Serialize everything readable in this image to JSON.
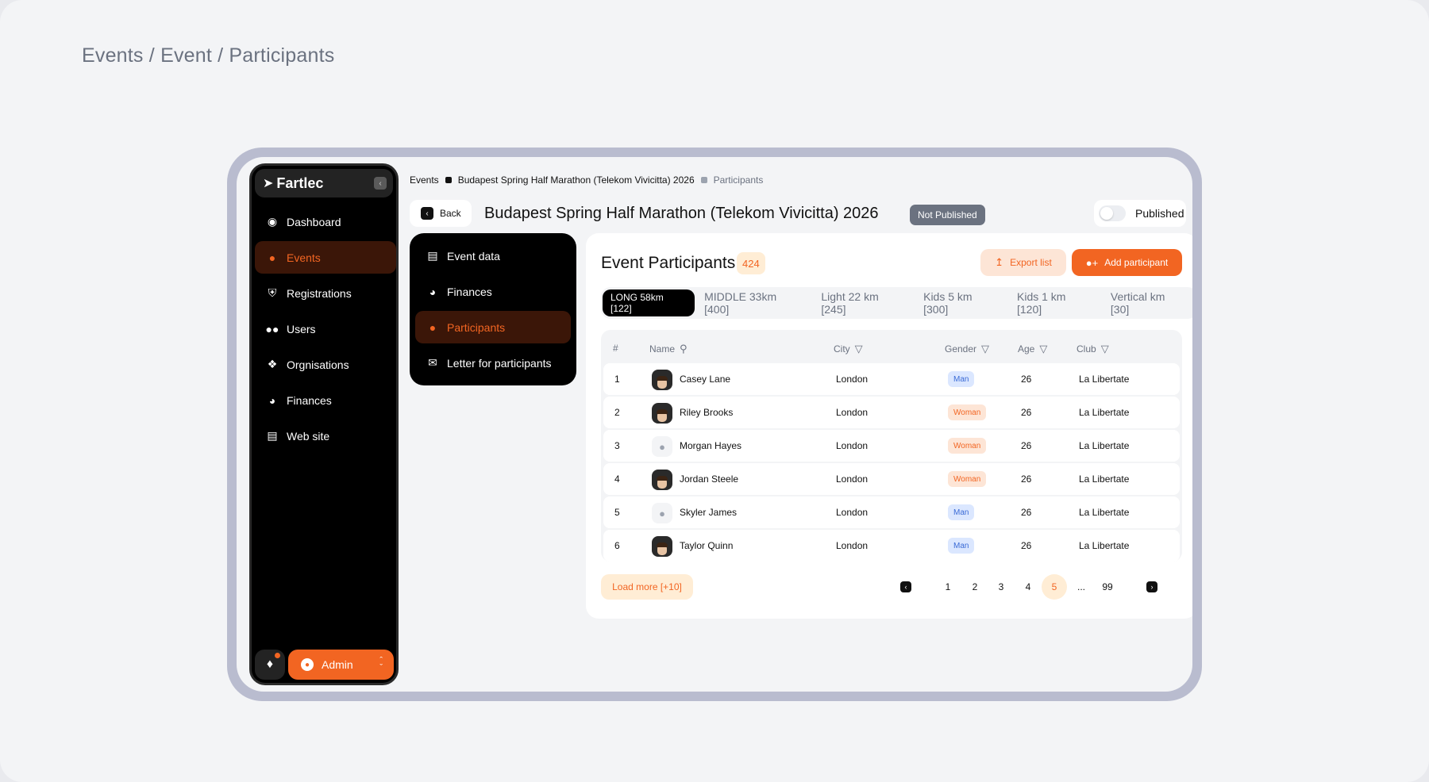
{
  "page": {
    "title": "Events / Event / Participants"
  },
  "sidebar": {
    "brand": "Fartlec",
    "items": [
      {
        "label": "Dashboard",
        "icon": "dashboard-icon"
      },
      {
        "label": "Events",
        "icon": "person-icon",
        "active": true
      },
      {
        "label": "Registrations",
        "icon": "shield-icon"
      },
      {
        "label": "Users",
        "icon": "users-icon"
      },
      {
        "label": "Orgnisations",
        "icon": "grid-icon"
      },
      {
        "label": "Finances",
        "icon": "money-bag-icon"
      },
      {
        "label": "Web site",
        "icon": "clipboard-icon"
      }
    ],
    "admin_label": "Admin"
  },
  "breadcrumb": [
    "Events",
    "Budapest Spring Half Marathon (Telekom Vivicitta) 2026",
    "Participants"
  ],
  "header": {
    "back_label": "Back",
    "event_title": "Budapest Spring Half Marathon (Telekom Vivicitta) 2026",
    "status": "Not Published",
    "publish_label": "Published",
    "published": false
  },
  "subnav": {
    "items": [
      {
        "label": "Event data",
        "icon": "book-icon"
      },
      {
        "label": "Finances",
        "icon": "money-bag-icon"
      },
      {
        "label": "Participants",
        "icon": "person-icon",
        "active": true
      },
      {
        "label": "Letter for participants",
        "icon": "mail-icon"
      }
    ]
  },
  "participants": {
    "title": "Event Participants",
    "count": "424",
    "export_label": "Export list",
    "add_label": "Add participant",
    "tabs": [
      {
        "label": "LONG 58km [122]",
        "active": true
      },
      {
        "label": "MIDDLE 33km [400]"
      },
      {
        "label": "Light 22 km [245]"
      },
      {
        "label": "Kids 5 km [300]"
      },
      {
        "label": "Kids 1 km [120]"
      },
      {
        "label": "Vertical km [30]"
      }
    ],
    "columns": {
      "num": "#",
      "name": "Name",
      "city": "City",
      "gender": "Gender",
      "age": "Age",
      "club": "Club"
    },
    "rows": [
      {
        "num": "1",
        "name": "Casey Lane",
        "city": "London",
        "gender": "Man",
        "age": "26",
        "club": "La Libertate",
        "photo": true
      },
      {
        "num": "2",
        "name": "Riley Brooks",
        "city": "London",
        "gender": "Woman",
        "age": "26",
        "club": "La Libertate",
        "photo": true
      },
      {
        "num": "3",
        "name": "Morgan Hayes",
        "city": "London",
        "gender": "Woman",
        "age": "26",
        "club": "La Libertate",
        "photo": false
      },
      {
        "num": "4",
        "name": "Jordan Steele",
        "city": "London",
        "gender": "Woman",
        "age": "26",
        "club": "La Libertate",
        "photo": true
      },
      {
        "num": "5",
        "name": "Skyler James",
        "city": "London",
        "gender": "Man",
        "age": "26",
        "club": "La Libertate",
        "photo": false
      },
      {
        "num": "6",
        "name": "Taylor Quinn",
        "city": "London",
        "gender": "Man",
        "age": "26",
        "club": "La Libertate",
        "photo": true
      }
    ],
    "load_more_label": "Load more [+10]",
    "pagination": {
      "pages": [
        "1",
        "2",
        "3",
        "4",
        "5"
      ],
      "ellipsis": "...",
      "last": "99",
      "current": "5"
    }
  },
  "colors": {
    "accent": "#f26522",
    "sidebar_bg": "#000000",
    "page_bg": "#f3f4f6"
  }
}
